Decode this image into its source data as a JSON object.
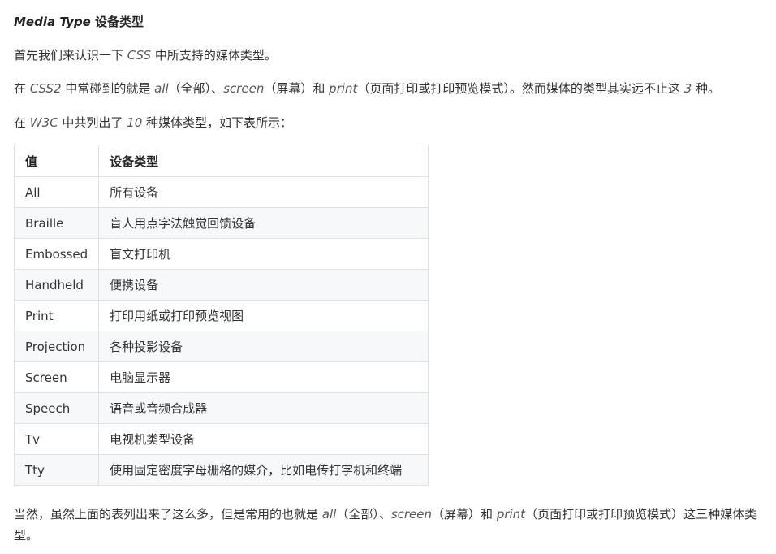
{
  "heading": {
    "italic": "Media Type",
    "text": " 设备类型"
  },
  "paragraphs": {
    "intro": {
      "a": "首先我们来认识一下 ",
      "css": "CSS",
      "b": " 中所支持的媒体类型。"
    },
    "css2": {
      "a": "在 ",
      "css2": "CSS2",
      "b": " 中常碰到的就是 ",
      "all": "all",
      "c": "（全部）、",
      "screen": "screen",
      "d": "（屏幕）和 ",
      "print": "print",
      "e": "（页面打印或打印预览模式）。然而媒体的类型其实远不止这 ",
      "three": "3",
      "f": " 种。"
    },
    "w3c": {
      "a": "在 ",
      "w3c": "W3C",
      "b": " 中共列出了 ",
      "ten": "10",
      "c": " 种媒体类型，如下表所示："
    },
    "outro": {
      "a": "当然，虽然上面的表列出来了这么多，但是常用的也就是 ",
      "all": "all",
      "b": "（全部）、",
      "screen": "screen",
      "c": "（屏幕）和 ",
      "print": "print",
      "d": "（页面打印或打印预览模式）这三种媒体类型。"
    }
  },
  "table": {
    "headers": {
      "value": "值",
      "device": "设备类型"
    },
    "rows": [
      {
        "value": "All",
        "device": "所有设备"
      },
      {
        "value": "Braille",
        "device": "盲人用点字法触觉回馈设备"
      },
      {
        "value": "Embossed",
        "device": "盲文打印机"
      },
      {
        "value": "Handheld",
        "device": "便携设备"
      },
      {
        "value": "Print",
        "device": "打印用纸或打印预览视图"
      },
      {
        "value": "Projection",
        "device": "各种投影设备"
      },
      {
        "value": "Screen",
        "device": "电脑显示器"
      },
      {
        "value": "Speech",
        "device": "语音或音频合成器"
      },
      {
        "value": "Tv",
        "device": "电视机类型设备"
      },
      {
        "value": "Tty",
        "device": "使用固定密度字母栅格的媒介，比如电传打字机和终端"
      }
    ]
  }
}
